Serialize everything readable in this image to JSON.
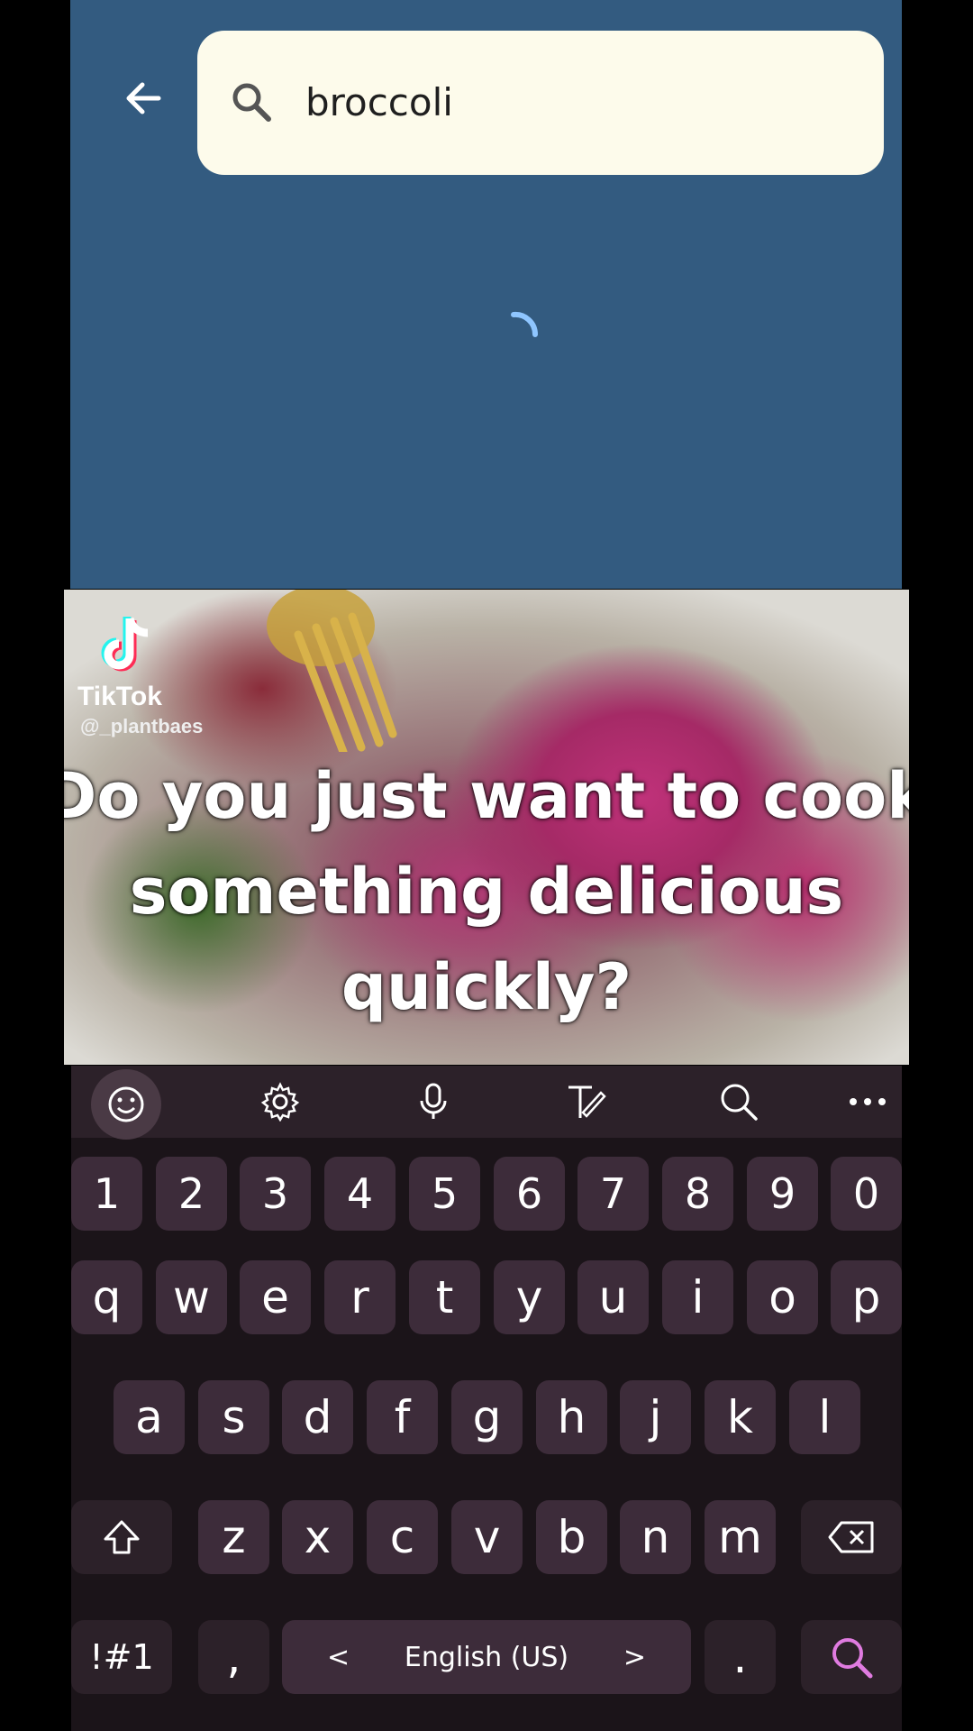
{
  "search": {
    "query": "broccoli"
  },
  "video": {
    "watermark_name": "TikTok",
    "watermark_handle": "@_plantbaes",
    "caption": "Do you just want to cook something delicious quickly?"
  },
  "keyboard": {
    "toolbar": [
      "emoji-icon",
      "gear-icon",
      "microphone-icon",
      "handwriting-icon",
      "search-icon",
      "more-icon"
    ],
    "numbers": [
      "1",
      "2",
      "3",
      "4",
      "5",
      "6",
      "7",
      "8",
      "9",
      "0"
    ],
    "row1": [
      "q",
      "w",
      "e",
      "r",
      "t",
      "y",
      "u",
      "i",
      "o",
      "p"
    ],
    "row2": [
      "a",
      "s",
      "d",
      "f",
      "g",
      "h",
      "j",
      "k",
      "l"
    ],
    "row3": [
      "z",
      "x",
      "c",
      "v",
      "b",
      "n",
      "m"
    ],
    "symbols_label": "!#1",
    "comma_label": ",",
    "space_label": "English (US)",
    "lang_prev": "<",
    "lang_next": ">",
    "period_label": "."
  },
  "colors": {
    "app_background": "#335b80",
    "search_background": "#fdfbeb",
    "keyboard_background": "#1b1419",
    "key_background": "#3d2c3a",
    "accent": "#e07be0"
  }
}
